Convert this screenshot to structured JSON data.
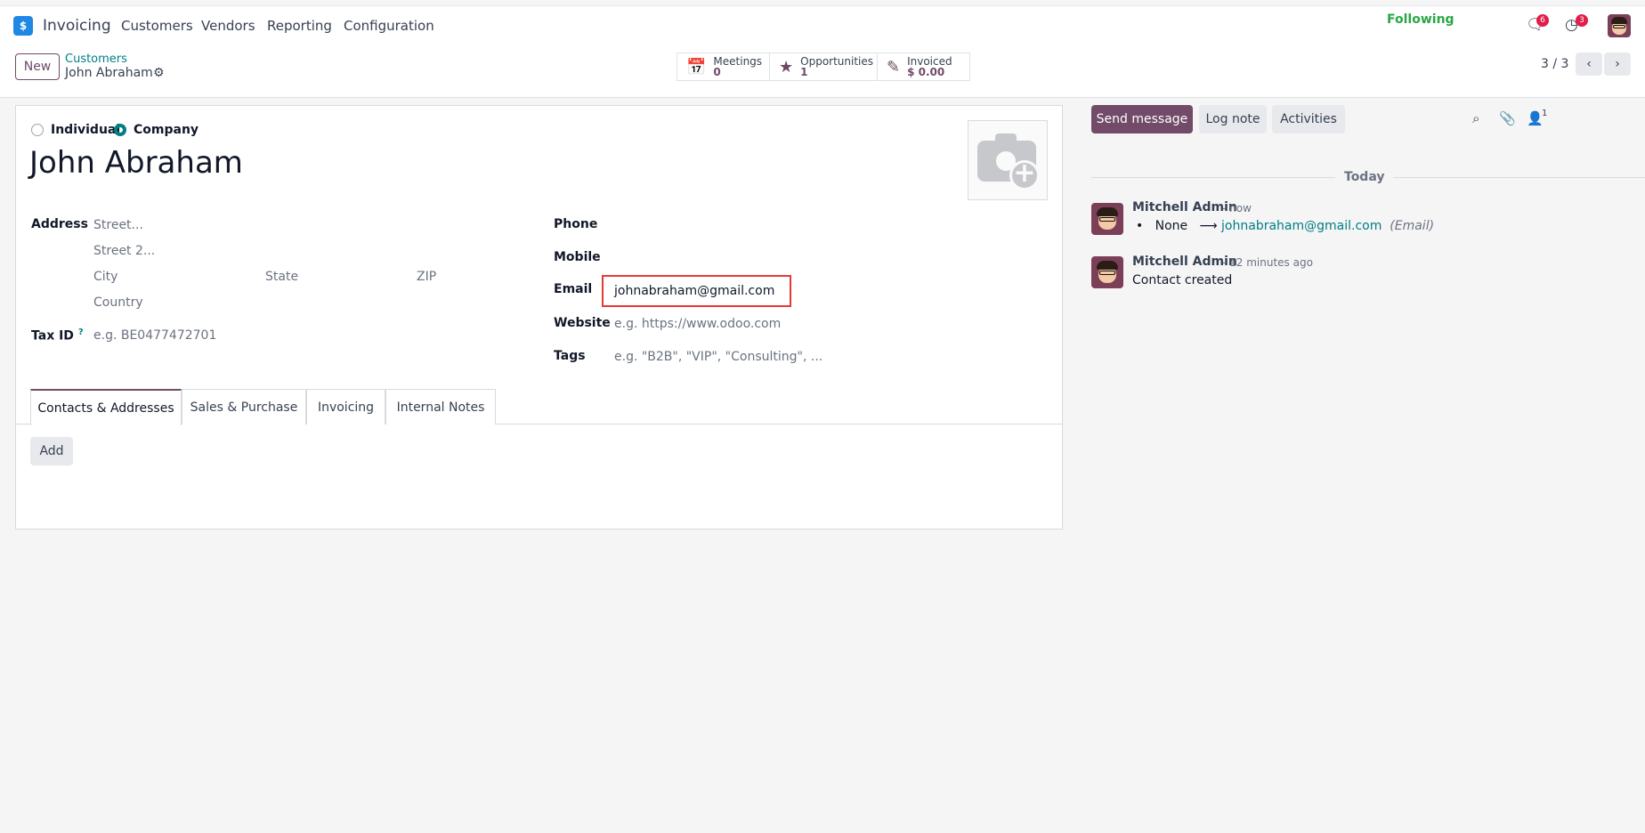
{
  "topbar": {
    "app_name": "Invoicing",
    "logo_glyph": "$",
    "nav": [
      "Customers",
      "Vendors",
      "Reporting",
      "Configuration"
    ],
    "messages_count": "6",
    "activities_count": "3"
  },
  "control": {
    "new_label": "New",
    "breadcrumb_parent": "Customers",
    "breadcrumb_current": "John Abraham",
    "smart_buttons": [
      {
        "label": "Meetings",
        "value": "0"
      },
      {
        "label": "Opportunities",
        "value": "1"
      },
      {
        "label": "Invoiced",
        "value": "$ 0.00"
      }
    ],
    "pager": "3 / 3"
  },
  "form": {
    "type_options": [
      "Individual",
      "Company"
    ],
    "type_selected": "Company",
    "name": "John Abraham",
    "address_label": "Address",
    "street_placeholder": "Street...",
    "street2_placeholder": "Street 2...",
    "city_placeholder": "City",
    "state_placeholder": "State",
    "zip_placeholder": "ZIP",
    "country_placeholder": "Country",
    "taxid_label": "Tax ID",
    "taxid_help": "?",
    "taxid_placeholder": "e.g. BE0477472701",
    "phone_label": "Phone",
    "mobile_label": "Mobile",
    "email_label": "Email",
    "email_value": "johnabraham@gmail.com",
    "website_label": "Website",
    "website_placeholder": "e.g. https://www.odoo.com",
    "tags_label": "Tags",
    "tags_placeholder": "e.g. \"B2B\", \"VIP\", \"Consulting\", ...",
    "tabs": [
      "Contacts & Addresses",
      "Sales & Purchase",
      "Invoicing",
      "Internal Notes"
    ],
    "active_tab": "Contacts & Addresses",
    "add_label": "Add"
  },
  "chatter": {
    "send_message": "Send message",
    "log_note": "Log note",
    "activities": "Activities",
    "followers_count": "1",
    "following": "Following",
    "date_separator": "Today",
    "messages": [
      {
        "author": "Mitchell Admin",
        "time": "- now",
        "old_value": "None",
        "arrow": "⟶",
        "new_value": "johnabraham@gmail.com",
        "field": "(Email)"
      },
      {
        "author": "Mitchell Admin",
        "time": "- 12 minutes ago",
        "body": "Contact created"
      }
    ]
  },
  "colors": {
    "brand": "#714b67",
    "teal": "#017e84",
    "following": "#28a745",
    "highlight": "#e53935"
  }
}
